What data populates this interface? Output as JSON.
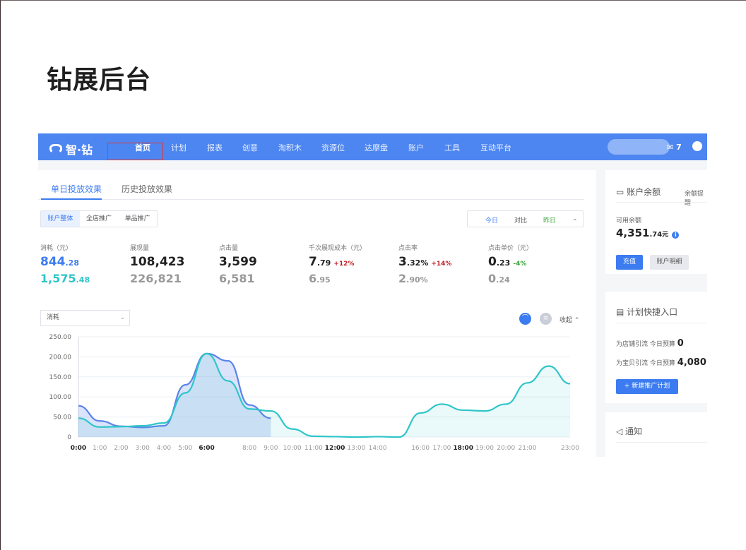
{
  "page_title": "钻展后台",
  "nav": {
    "logo": "智·钻",
    "items": [
      "首页",
      "计划",
      "报表",
      "创意",
      "淘积木",
      "资源位",
      "达摩盘",
      "账户",
      "工具",
      "互动平台"
    ],
    "active": "首页",
    "mail_count": "7"
  },
  "tabs": [
    "单日投放效果",
    "历史投放效果"
  ],
  "segments": [
    "账户整体",
    "全店推广",
    "单品推广"
  ],
  "day_segments": [
    "今日",
    "对比",
    "昨日"
  ],
  "metrics": [
    {
      "label": "消耗（元）",
      "v1_main": "844",
      "v1_dec": ".28",
      "v2_main": "1,575",
      "v2_dec": ".48",
      "change": ""
    },
    {
      "label": "展现量",
      "v1_main": "108,423",
      "v1_dec": "",
      "v2_main": "226,821",
      "v2_dec": "",
      "change": ""
    },
    {
      "label": "点击量",
      "v1_main": "3,599",
      "v1_dec": "",
      "v2_main": "6,581",
      "v2_dec": "",
      "change": ""
    },
    {
      "label": "千次展现成本（元）",
      "v1_main": "7",
      "v1_dec": ".79",
      "v2_main": "6",
      "v2_dec": ".95",
      "change": "+12%"
    },
    {
      "label": "点击率",
      "v1_main": "3",
      "v1_dec": ".32%",
      "v2_main": "2",
      "v2_dec": ".90%",
      "change": "+14%"
    },
    {
      "label": "点击单价（元）",
      "v1_main": "0",
      "v1_dec": ".23",
      "v2_main": "0",
      "v2_dec": ".24",
      "change": "-4%"
    }
  ],
  "chart_controls": {
    "metric": "消耗",
    "collapse": "收起"
  },
  "chart_data": {
    "type": "line",
    "ylim": [
      0,
      250
    ],
    "yticks": [
      "250.00",
      "200.00",
      "150.00",
      "100.00",
      "50.00",
      "0"
    ],
    "xticks": [
      "0:00",
      "1:00",
      "2:00",
      "3:00",
      "4:00",
      "5:00",
      "6:00",
      "8:00",
      "9:00",
      "10:00",
      "11:00",
      "12:00",
      "13:00",
      "14:00",
      "16:00",
      "17:00",
      "18:00",
      "19:00",
      "20:00",
      "21:00",
      "23:00"
    ],
    "bold_ticks": [
      "0:00",
      "6:00",
      "12:00",
      "18:00"
    ],
    "series": [
      {
        "color": "#5b84ea",
        "hours": [
          0,
          1,
          2,
          3,
          4,
          5,
          6,
          7,
          8,
          9
        ],
        "values": [
          78,
          40,
          27,
          24,
          28,
          130,
          208,
          190,
          80,
          47
        ]
      },
      {
        "color": "#2fc5c9",
        "hours": [
          0,
          1,
          2,
          3,
          4,
          5,
          6,
          7,
          8,
          9,
          10,
          11,
          12,
          13,
          14,
          15,
          16,
          17,
          18,
          19,
          20,
          21,
          22,
          23
        ],
        "values": [
          47,
          25,
          26,
          28,
          35,
          110,
          208,
          140,
          70,
          65,
          20,
          2,
          1,
          0,
          1,
          0,
          60,
          82,
          67,
          65,
          82,
          135,
          177,
          133
        ]
      }
    ]
  },
  "side": {
    "balance_title": "账户余额",
    "balance_link": "余额提醒",
    "available_label": "可用余额",
    "balance_main": "4,351",
    "balance_dec": ".74",
    "balance_unit": "元",
    "recharge": "充值",
    "details": "账户明细",
    "plan_title": "计划快捷入口",
    "plan_rows": [
      {
        "name": "为店铺引流",
        "budget_label": "今日预算",
        "budget": "0"
      },
      {
        "name": "为宝贝引流",
        "budget_label": "今日预算",
        "budget": "4,080"
      }
    ],
    "new_plan": "+ 新建推广计划",
    "notice_title": "通知"
  }
}
